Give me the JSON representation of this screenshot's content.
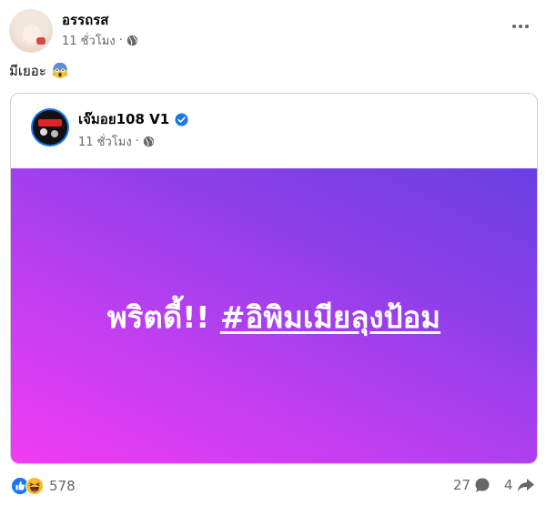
{
  "post": {
    "author": "อรรถรส",
    "time": "11 ชั่วโมง",
    "separator": "·",
    "audience_icon": "globe-icon",
    "text": "มีเยอะ",
    "text_emoji": "face-screaming-in-fear-emoji"
  },
  "shared": {
    "page_name": "เจ๊มอย108 V1",
    "verified_icon": "verified-badge-icon",
    "time": "11 ชั่วโมง",
    "separator": "·",
    "background_text_prefix": "พริตดี้!! ",
    "background_text_hashtag": "#อิพิมเมียลุงป้อม",
    "gradient_colors": [
      "#f23cf2",
      "#bb3ff0",
      "#8a3fe9",
      "#6a3fe3"
    ]
  },
  "footer": {
    "reaction_icons": [
      "like-icon",
      "haha-icon"
    ],
    "reaction_count": "578",
    "comment_count": "27",
    "comment_icon": "comment-icon",
    "share_count": "4",
    "share_icon": "share-icon"
  },
  "colors": {
    "text_primary": "#050505",
    "text_secondary": "#65676b",
    "like_blue": "#1877f2",
    "haha_yellow": "#f7b928"
  }
}
